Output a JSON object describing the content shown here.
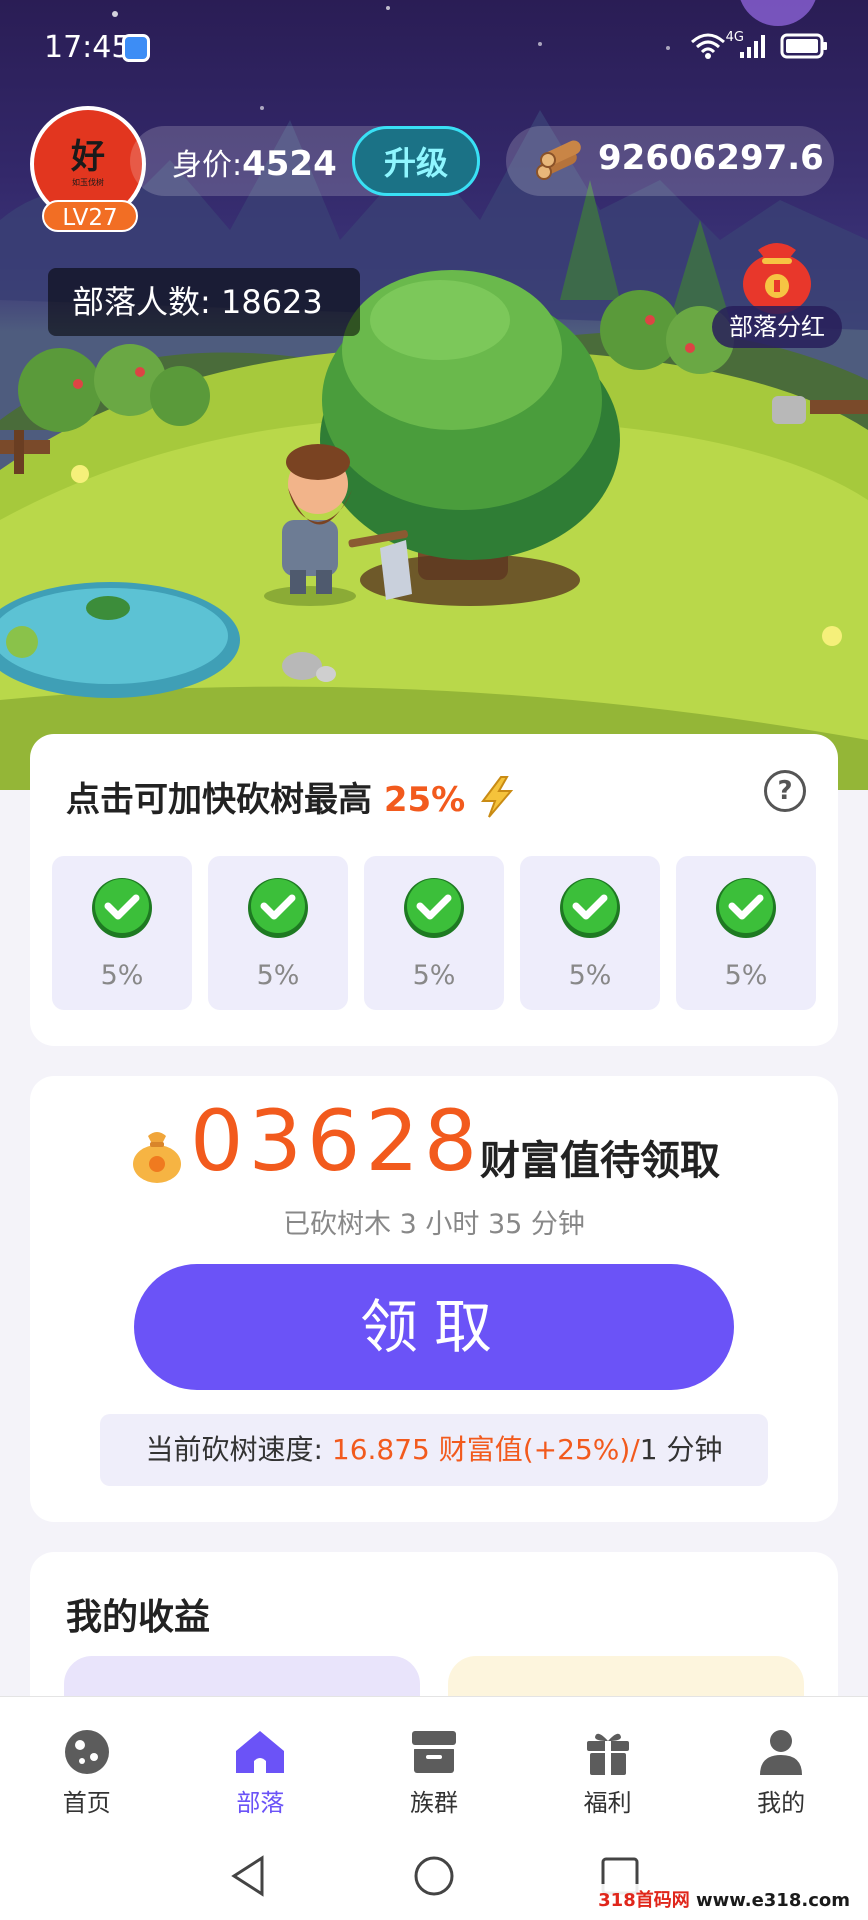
{
  "status_bar": {
    "time": "17:45",
    "network": "4G"
  },
  "header": {
    "avatar_char": "好",
    "avatar_sub": "如玉伐树",
    "level": "LV27",
    "worth_label": "身价:",
    "worth_value": "4524",
    "upgrade_label": "升级",
    "wood_amount": "92606297.6"
  },
  "tribe": {
    "count_label": "部落人数:",
    "count_value": "18623",
    "dividend_label": "部落分红"
  },
  "boost": {
    "title_prefix": "点击可加快砍树最高",
    "title_highlight": "25%",
    "help": "?",
    "items": [
      {
        "pct": "5%"
      },
      {
        "pct": "5%"
      },
      {
        "pct": "5%"
      },
      {
        "pct": "5%"
      },
      {
        "pct": "5%"
      }
    ]
  },
  "wealth": {
    "value": "03628",
    "label": "财富值待领取",
    "elapsed": "已砍树木 3 小时 35 分钟",
    "claim_label": "领取",
    "speed_prefix": "当前砍树速度:",
    "speed_value": "16.875 财富值(+25%)/",
    "speed_suffix": "1 分钟"
  },
  "income": {
    "title": "我的收益"
  },
  "tabs": [
    {
      "label": "首页",
      "icon": "planet-icon"
    },
    {
      "label": "部落",
      "icon": "home-icon",
      "active": true
    },
    {
      "label": "族群",
      "icon": "store-icon"
    },
    {
      "label": "福利",
      "icon": "gift-icon"
    },
    {
      "label": "我的",
      "icon": "user-icon"
    }
  ],
  "watermark": {
    "left": "318首码网",
    "right": " www.e318.com"
  },
  "colors": {
    "accent": "#6b53f7",
    "highlight": "#f25a1d"
  }
}
